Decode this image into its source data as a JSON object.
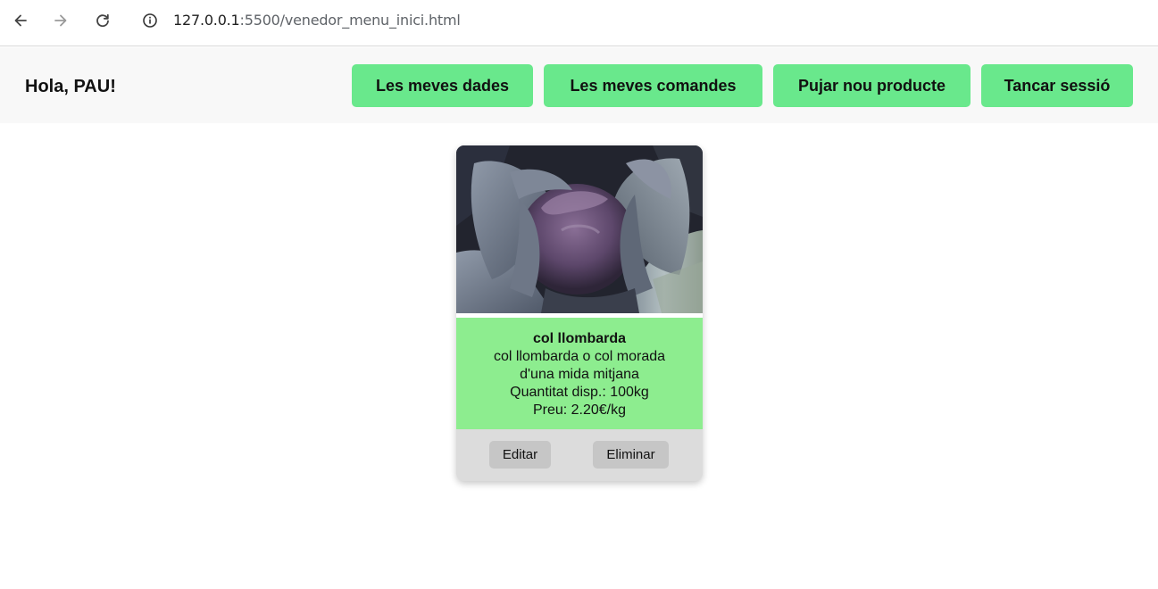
{
  "browser": {
    "url_host": "127.0.0.1",
    "url_path": ":5500/venedor_menu_inici.html",
    "icons": {
      "back": "arrow-left-icon",
      "forward": "arrow-right-icon",
      "reload": "reload-icon",
      "site_info": "info-icon"
    }
  },
  "header": {
    "greeting": "Hola, PAU!",
    "buttons": {
      "dades": "Les meves dades",
      "comandes": "Les meves comandes",
      "pujar": "Pujar nou producte",
      "tancar": "Tancar sessió"
    },
    "button_color": "#69e88c",
    "background": "#f8f8f8"
  },
  "products": [
    {
      "name": "col llombarda",
      "description": "col llombarda o col morada d'una mida mitjana",
      "quantity": "Quantitat disp.: 100kg",
      "price": "Preu: 2.20€/kg",
      "image": "red-cabbage-photo",
      "actions": {
        "edit": "Editar",
        "delete": "Eliminar"
      },
      "info_color": "#8ded8f"
    }
  ]
}
